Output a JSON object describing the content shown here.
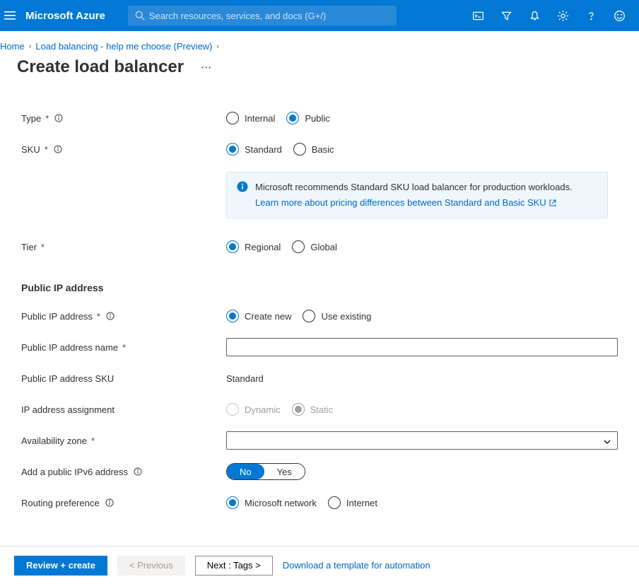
{
  "topbar": {
    "brand": "Microsoft Azure",
    "search_placeholder": "Search resources, services, and docs (G+/)"
  },
  "breadcrumbs": {
    "home": "Home",
    "lb": "Load balancing - help me choose (Preview)"
  },
  "page": {
    "title": "Create load balancer"
  },
  "form": {
    "type_label": "Type",
    "type_internal": "Internal",
    "type_public": "Public",
    "sku_label": "SKU",
    "sku_standard": "Standard",
    "sku_basic": "Basic",
    "sku_info_text": "Microsoft recommends Standard SKU load balancer for production workloads.",
    "sku_info_link": "Learn more about pricing differences between Standard and Basic SKU",
    "tier_label": "Tier",
    "tier_regional": "Regional",
    "tier_global": "Global",
    "section_pip": "Public IP address",
    "pip_label": "Public IP address",
    "pip_create": "Create new",
    "pip_existing": "Use existing",
    "pip_name_label": "Public IP address name",
    "pip_name_value": "",
    "pip_sku_label": "Public IP address SKU",
    "pip_sku_value": "Standard",
    "ip_assign_label": "IP address assignment",
    "ip_dynamic": "Dynamic",
    "ip_static": "Static",
    "az_label": "Availability zone",
    "az_value": "",
    "ipv6_label": "Add a public IPv6 address",
    "ipv6_no": "No",
    "ipv6_yes": "Yes",
    "route_label": "Routing preference",
    "route_ms": "Microsoft network",
    "route_internet": "Internet"
  },
  "footer": {
    "review": "Review + create",
    "prev": "< Previous",
    "next": "Next : Tags >",
    "template_link": "Download a template for automation"
  }
}
